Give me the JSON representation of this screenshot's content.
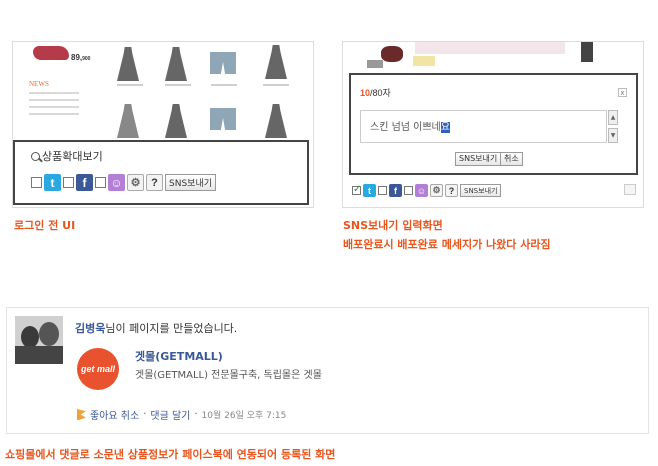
{
  "left_panel": {
    "brand_price": "89,",
    "brand_price_suffix": "900",
    "news_label": "NEWS",
    "zoom_label": "상품확대보기",
    "help_label": "?",
    "sns_button": "SNS보내기",
    "caption": "로그인 전 UI"
  },
  "right_panel": {
    "count_current": "10",
    "count_rest": "/80자",
    "close": "x",
    "text_value": "스킨 넘넘 이쁘네",
    "text_caret": "요",
    "send_button": "SNS보내기",
    "cancel_button": "취소",
    "mini_help": "?",
    "mini_send": "SNS보내기",
    "caption_line1": "SNS보내기 입력화면",
    "caption_line2": "배포완료시 배포완료 메세지가 나왔다 사라짐"
  },
  "facebook_post": {
    "author": "김병욱",
    "author_suffix": "님이 페이지를 만들었습니다.",
    "logo_text": "get mall",
    "page_title": "겟몰(GETMALL)",
    "page_desc": "겟몰(GETMALL) 전문몰구축, 독립몰은 겟몰",
    "like_cancel": "좋아요 취소",
    "separator": "·",
    "comment": "댓글 달기",
    "timestamp": "10월 26일 오후 7:15"
  },
  "bottom_caption": "쇼핑몰에서 댓글로 소문낸 상품정보가 페이스북에 연동되어 등록된 화면",
  "colors": {
    "caption": "#e8561f",
    "facebook_blue": "#3b5998",
    "twitter": "#2aa9e0",
    "me2day": "#b37fd6"
  },
  "icons": [
    "search-icon",
    "twitter-icon",
    "facebook-icon",
    "me2day-icon",
    "gear-icon",
    "help-icon",
    "close-icon",
    "like-flag-icon"
  ]
}
